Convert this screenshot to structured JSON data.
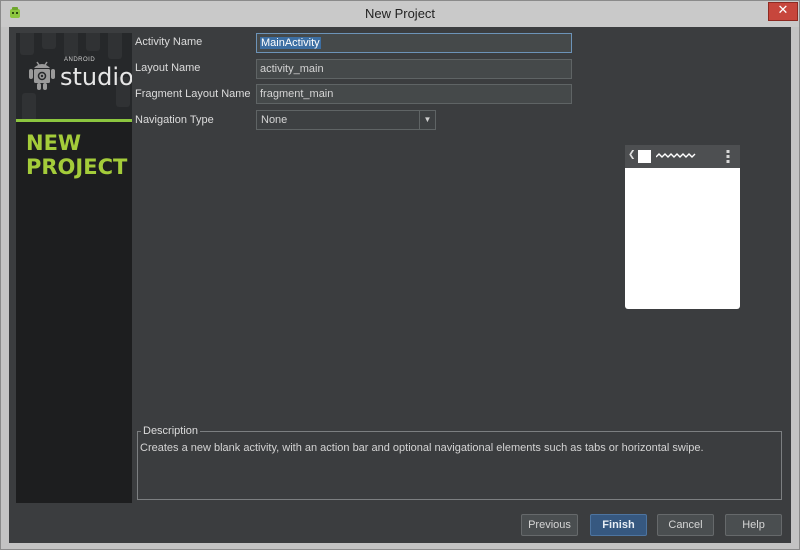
{
  "window": {
    "title": "New Project",
    "close_glyph": "✕"
  },
  "brand": {
    "small_word": "ANDROID",
    "word": "studio",
    "heading_line1": "NEW",
    "heading_line2": "PROJECT",
    "accent_color": "#8cc63f"
  },
  "form": {
    "activity_name": {
      "label": "Activity Name",
      "value": "MainActivity"
    },
    "layout_name": {
      "label": "Layout Name",
      "value": "activity_main"
    },
    "fragment_layout_name": {
      "label": "Fragment Layout Name",
      "value": "fragment_main"
    },
    "navigation_type": {
      "label": "Navigation Type",
      "value": "None",
      "arrow": "▼"
    }
  },
  "preview": {
    "back_glyph": "❮"
  },
  "description": {
    "legend": "Description",
    "text": "Creates a new blank activity, with an action bar and optional navigational elements such as tabs or horizontal swipe."
  },
  "buttons": {
    "previous": "Previous",
    "finish": "Finish",
    "cancel": "Cancel",
    "help": "Help"
  }
}
